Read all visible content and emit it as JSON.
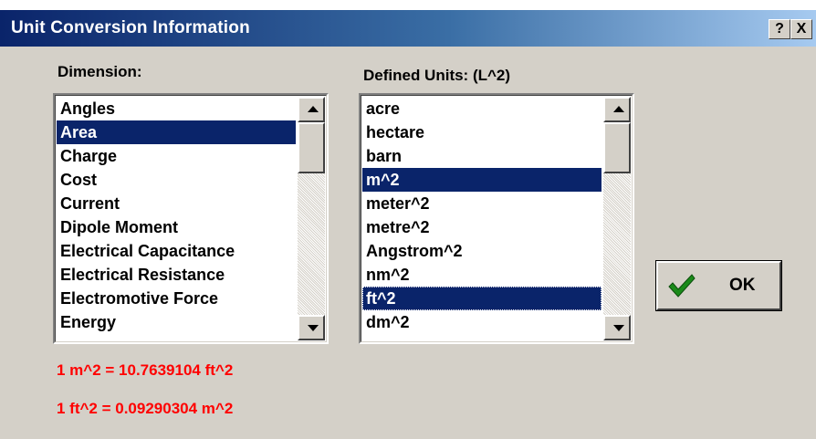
{
  "window": {
    "title": "Unit Conversion Information",
    "help_label": "?",
    "close_label": "X"
  },
  "dimension": {
    "label": "Dimension:",
    "items": [
      "Angles",
      "Area",
      "Charge",
      "Cost",
      "Current",
      "Dipole Moment",
      "Electrical Capacitance",
      "Electrical Resistance",
      "Electromotive Force",
      "Energy"
    ],
    "selected": "Area"
  },
  "units": {
    "label": "Defined Units:  (L^2)",
    "items": [
      "acre",
      "hectare",
      "barn",
      "m^2",
      "meter^2",
      "metre^2",
      "Angstrom^2",
      "nm^2",
      "ft^2",
      "dm^2"
    ],
    "selected": [
      "m^2",
      "ft^2"
    ],
    "focused": "ft^2"
  },
  "ok_button": {
    "label": "OK",
    "icon": "check-icon"
  },
  "conversions": [
    "1 m^2 = 10.7639104 ft^2",
    "1 ft^2 = 0.09290304 m^2"
  ],
  "colors": {
    "selection": "#0a246a",
    "conversion_text": "#ff0000",
    "check": "#1a8a1a"
  }
}
